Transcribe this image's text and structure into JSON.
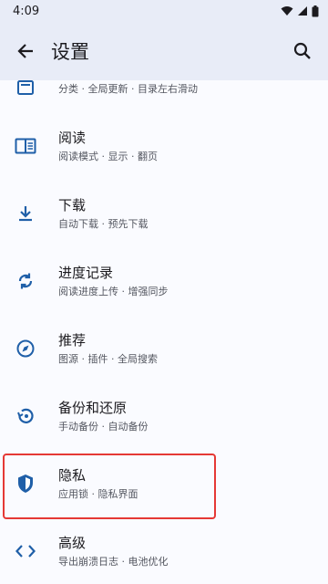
{
  "status": {
    "time": "4:09"
  },
  "appbar": {
    "title": "设置"
  },
  "items": [
    {
      "title": "",
      "subtitle": "分类 · 全局更新 · 目录左右滑动"
    },
    {
      "title": "阅读",
      "subtitle": "阅读模式 · 显示 · 翻页"
    },
    {
      "title": "下载",
      "subtitle": "自动下载 · 预先下载"
    },
    {
      "title": "进度记录",
      "subtitle": "阅读进度上传 · 增强同步"
    },
    {
      "title": "推荐",
      "subtitle": "图源 · 插件 · 全局搜索"
    },
    {
      "title": "备份和还原",
      "subtitle": "手动备份 · 自动备份"
    },
    {
      "title": "隐私",
      "subtitle": "应用锁 · 隐私界面"
    },
    {
      "title": "高级",
      "subtitle": "导出崩溃日志 · 电池优化"
    }
  ],
  "colors": {
    "accent": "#1f5fa8",
    "highlight": "#e53935",
    "bar": "#e8ecf7"
  }
}
